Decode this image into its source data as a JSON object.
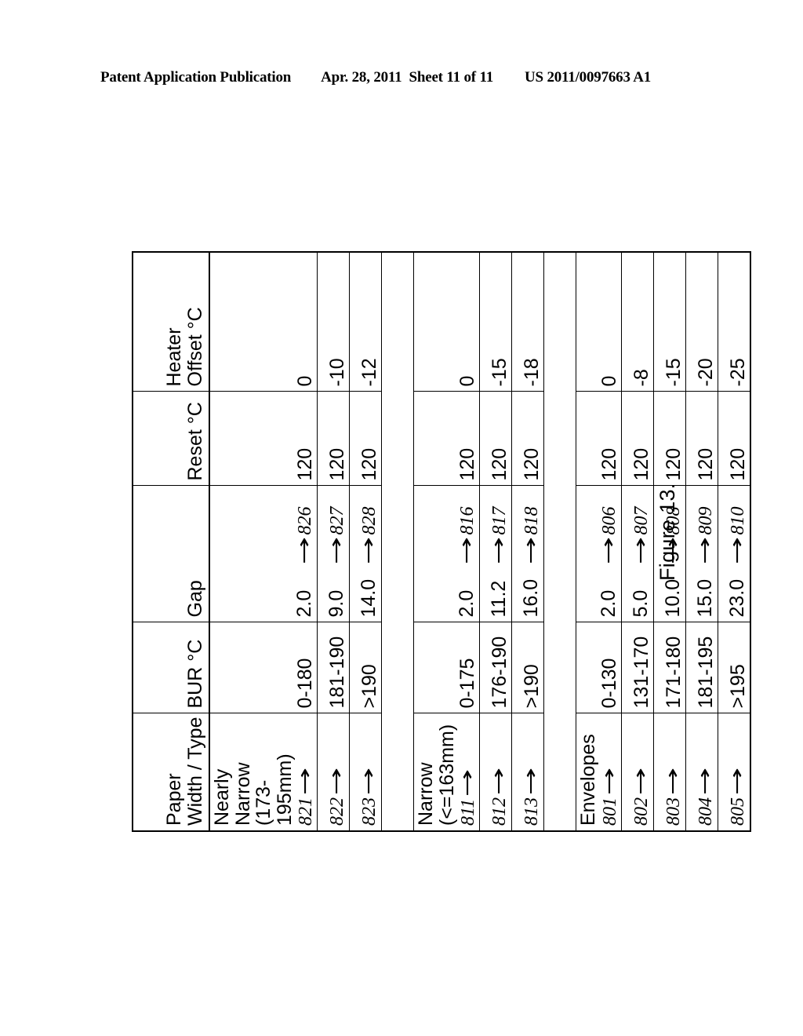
{
  "header": {
    "publication": "Patent Application Publication",
    "date": "Apr. 28, 2011",
    "sheet": "Sheet 11 of 11",
    "patent_number": "US 2011/0097663 A1"
  },
  "figure": {
    "caption": "Figure 13."
  },
  "table": {
    "columns": [
      {
        "key": "type",
        "header": "Paper\nWidth / Type"
      },
      {
        "key": "bur",
        "header": "BUR °C"
      },
      {
        "key": "gap",
        "header": "Gap"
      },
      {
        "key": "reset",
        "header": "Reset °C"
      },
      {
        "key": "heater",
        "header": "Heater\nOffset °C"
      }
    ],
    "groups": [
      {
        "label": "Nearly Narrow\n(173-195mm)",
        "rows": [
          {
            "ref": "821",
            "arrow": "→",
            "bur": "0-180",
            "gap": "2.0",
            "gap_arrow": "→",
            "gap_ref": "826",
            "reset": "120",
            "heater": "0"
          },
          {
            "ref": "822",
            "arrow": "→",
            "bur": "181-190",
            "gap": "9.0",
            "gap_arrow": "→",
            "gap_ref": "827",
            "reset": "120",
            "heater": "-10"
          },
          {
            "ref": "823",
            "arrow": "→",
            "bur": ">190",
            "gap": "14.0",
            "gap_arrow": "→",
            "gap_ref": "828",
            "reset": "120",
            "heater": "-12"
          }
        ]
      },
      {
        "label": "Narrow\n(<=163mm)",
        "rows": [
          {
            "ref": "811",
            "arrow": "→",
            "bur": "0-175",
            "gap": "2.0",
            "gap_arrow": "→",
            "gap_ref": "816",
            "reset": "120",
            "heater": "0"
          },
          {
            "ref": "812",
            "arrow": "→",
            "bur": "176-190",
            "gap": "11.2",
            "gap_arrow": "→",
            "gap_ref": "817",
            "reset": "120",
            "heater": "-15"
          },
          {
            "ref": "813",
            "arrow": "→",
            "bur": ">190",
            "gap": "16.0",
            "gap_arrow": "→",
            "gap_ref": "818",
            "reset": "120",
            "heater": "-18"
          }
        ]
      },
      {
        "label": "Envelopes",
        "rows": [
          {
            "ref": "801",
            "arrow": "→",
            "bur": "0-130",
            "gap": "2.0",
            "gap_arrow": "→",
            "gap_ref": "806",
            "reset": "120",
            "heater": "0"
          },
          {
            "ref": "802",
            "arrow": "→",
            "bur": "131-170",
            "gap": "5.0",
            "gap_arrow": "→",
            "gap_ref": "807",
            "reset": "120",
            "heater": "-8"
          },
          {
            "ref": "803",
            "arrow": "→",
            "bur": "171-180",
            "gap": "10.0",
            "gap_arrow": "→",
            "gap_ref": "808",
            "reset": "120",
            "heater": "-15"
          },
          {
            "ref": "804",
            "arrow": "→",
            "bur": "181-195",
            "gap": "15.0",
            "gap_arrow": "→",
            "gap_ref": "809",
            "reset": "120",
            "heater": "-20"
          },
          {
            "ref": "805",
            "arrow": "→",
            "bur": ">195",
            "gap": "23.0",
            "gap_arrow": "→",
            "gap_ref": "810",
            "reset": "120",
            "heater": "-25"
          }
        ]
      }
    ]
  }
}
